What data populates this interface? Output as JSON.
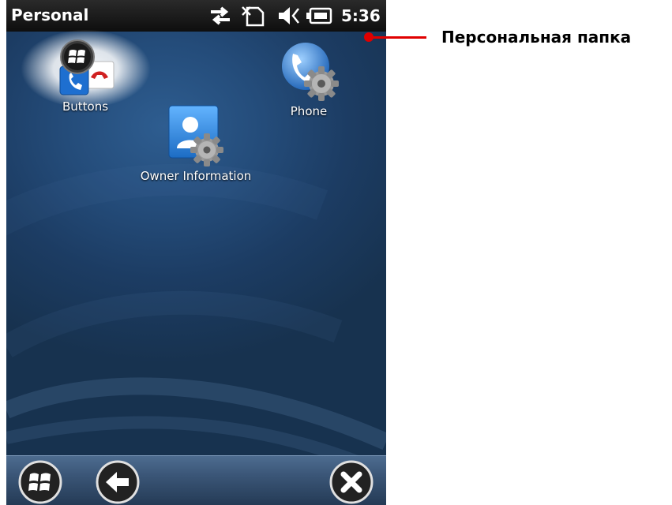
{
  "window": {
    "title": "Personal",
    "time": "5:36"
  },
  "status_icons": [
    "connectivity-arrows-icon",
    "no-sim-icon",
    "speaker-muted-icon",
    "battery-charging-icon"
  ],
  "icons": [
    {
      "label": "Buttons",
      "icon": "buttons-icon",
      "selected": true
    },
    {
      "label": "Phone",
      "icon": "phone-settings-icon",
      "selected": false
    },
    {
      "label": "Owner Information",
      "icon": "owner-information-icon",
      "selected": false
    }
  ],
  "softkeys": [
    "start-icon",
    "back-icon",
    "close-icon"
  ],
  "annotation": {
    "text": "Персональная папка",
    "color": "#e00000"
  },
  "colors": {
    "screen_bg": "#1c3c63",
    "titlebar": "#111111",
    "softbar": "#3a5576"
  }
}
